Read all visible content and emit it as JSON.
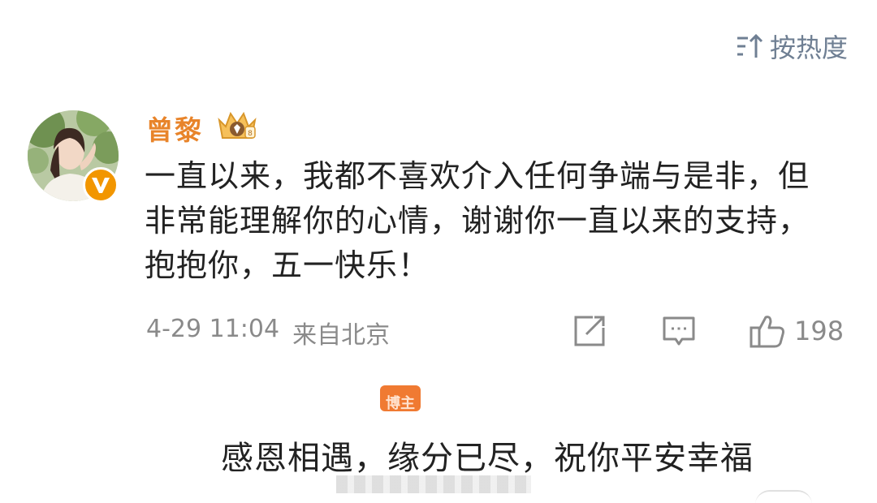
{
  "sort": {
    "label": "按热度",
    "icon": "sort-icon"
  },
  "comment": {
    "username": "曾黎",
    "avatar_icon": "avatar",
    "verified_icon": "verified-v-icon",
    "vip_icon": "vip-crown-icon",
    "text": "一直以来，我都不喜欢介入任何争端与是非，但非常能理解你的心情，谢谢你一直以来的支持，抱抱你，五一快乐！",
    "date": "4-29 11:04",
    "location": "来自北京",
    "like_count": "198"
  },
  "actions": {
    "share_icon": "share-icon",
    "reply_icon": "comment-icon",
    "like_icon": "like-icon"
  },
  "quoted": {
    "tag_icon": "tag-badge",
    "text": "感恩相遇，缘分已尽，祝你平安幸福"
  },
  "colors": {
    "username": "#e8842a",
    "text": "#222222",
    "meta": "#8a8a8a",
    "sort": "#6f7f93",
    "verified": "#f29600",
    "tag": "#f07a32"
  }
}
